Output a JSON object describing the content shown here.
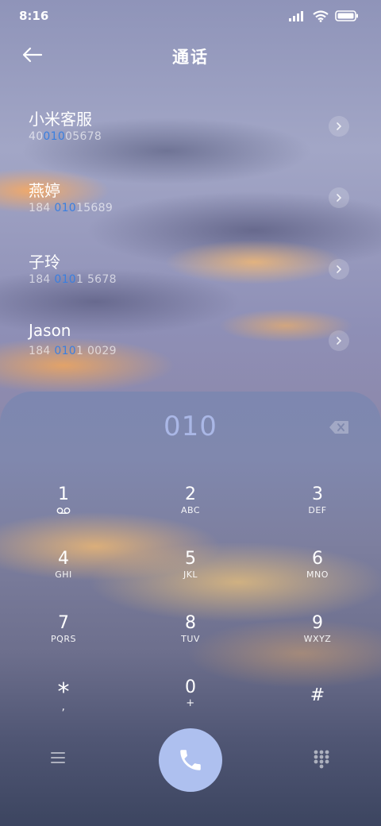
{
  "status_bar": {
    "time": "8:16",
    "icons": [
      "signal-icon",
      "wifi-icon",
      "battery-icon"
    ]
  },
  "header": {
    "back_icon": "back-arrow-icon",
    "title": "通话"
  },
  "contacts": [
    {
      "name": "小米客服",
      "number_pre": "40",
      "number_match": "010",
      "number_post": "05678"
    },
    {
      "name": "燕婷",
      "number_pre": "184 ",
      "number_match": "010",
      "number_post": "15689"
    },
    {
      "name": "子玲",
      "number_pre": "184 ",
      "number_match": "010",
      "number_post": "1 5678"
    },
    {
      "name": "Jason",
      "number_pre": "184 ",
      "number_match": "010",
      "number_post": "1 0029"
    }
  ],
  "dialer": {
    "entered_number": "010",
    "keys": [
      {
        "digit": "1",
        "letters": "voicemail-icon"
      },
      {
        "digit": "2",
        "letters": "ABC"
      },
      {
        "digit": "3",
        "letters": "DEF"
      },
      {
        "digit": "4",
        "letters": "GHI"
      },
      {
        "digit": "5",
        "letters": "JKL"
      },
      {
        "digit": "6",
        "letters": "MNO"
      },
      {
        "digit": "7",
        "letters": "PQRS"
      },
      {
        "digit": "8",
        "letters": "TUV"
      },
      {
        "digit": "9",
        "letters": "WXYZ"
      },
      {
        "digit": "*",
        "letters": ","
      },
      {
        "digit": "0",
        "letters": "+"
      },
      {
        "digit": "#",
        "letters": ""
      }
    ]
  },
  "colors": {
    "match_highlight": "#3a7fe0",
    "number_display": "#aab7e6",
    "call_button": "#aec0ef"
  }
}
